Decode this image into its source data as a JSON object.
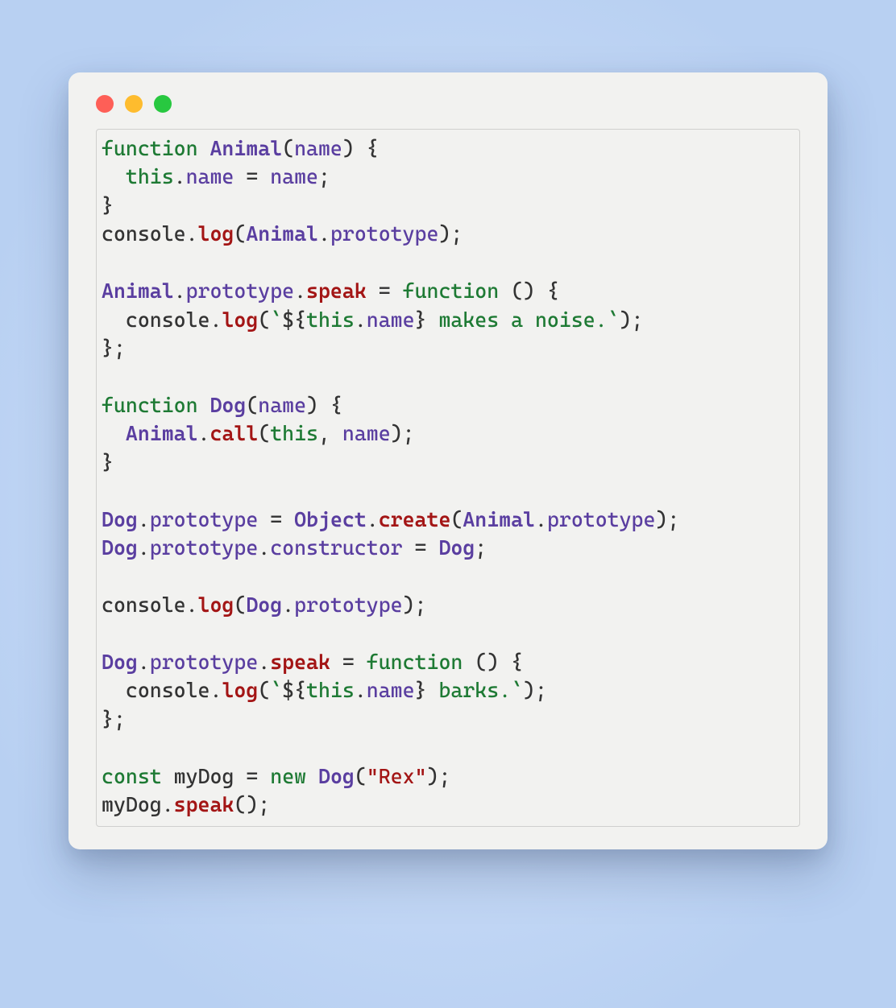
{
  "window": {
    "traffic_lights": [
      "close",
      "minimize",
      "zoom"
    ]
  },
  "code": {
    "lines": [
      [
        {
          "t": "kw",
          "v": "function"
        },
        {
          "t": "sp",
          "v": " "
        },
        {
          "t": "cls",
          "v": "Animal"
        },
        {
          "t": "paren",
          "v": "("
        },
        {
          "t": "prop",
          "v": "name"
        },
        {
          "t": "paren",
          "v": ")"
        },
        {
          "t": "sp",
          "v": " "
        },
        {
          "t": "brace",
          "v": "{"
        }
      ],
      [
        {
          "t": "sp",
          "v": "  "
        },
        {
          "t": "kw",
          "v": "this"
        },
        {
          "t": "dot",
          "v": "."
        },
        {
          "t": "prop",
          "v": "name"
        },
        {
          "t": "sp",
          "v": " "
        },
        {
          "t": "op",
          "v": "="
        },
        {
          "t": "sp",
          "v": " "
        },
        {
          "t": "prop",
          "v": "name"
        },
        {
          "t": "semi",
          "v": ";"
        }
      ],
      [
        {
          "t": "brace",
          "v": "}"
        }
      ],
      [
        {
          "t": "obj",
          "v": "console"
        },
        {
          "t": "dot",
          "v": "."
        },
        {
          "t": "meth",
          "v": "log"
        },
        {
          "t": "paren",
          "v": "("
        },
        {
          "t": "cls",
          "v": "Animal"
        },
        {
          "t": "dot",
          "v": "."
        },
        {
          "t": "prop",
          "v": "prototype"
        },
        {
          "t": "paren",
          "v": ")"
        },
        {
          "t": "semi",
          "v": ";"
        }
      ],
      [],
      [
        {
          "t": "cls",
          "v": "Animal"
        },
        {
          "t": "dot",
          "v": "."
        },
        {
          "t": "prop",
          "v": "prototype"
        },
        {
          "t": "dot",
          "v": "."
        },
        {
          "t": "meth",
          "v": "speak"
        },
        {
          "t": "sp",
          "v": " "
        },
        {
          "t": "op",
          "v": "="
        },
        {
          "t": "sp",
          "v": " "
        },
        {
          "t": "kw",
          "v": "function"
        },
        {
          "t": "sp",
          "v": " "
        },
        {
          "t": "paren",
          "v": "()"
        },
        {
          "t": "sp",
          "v": " "
        },
        {
          "t": "brace",
          "v": "{"
        }
      ],
      [
        {
          "t": "sp",
          "v": "  "
        },
        {
          "t": "obj",
          "v": "console"
        },
        {
          "t": "dot",
          "v": "."
        },
        {
          "t": "meth",
          "v": "log"
        },
        {
          "t": "paren",
          "v": "("
        },
        {
          "t": "tick",
          "v": "`"
        },
        {
          "t": "tmpl",
          "v": "${"
        },
        {
          "t": "kw",
          "v": "this"
        },
        {
          "t": "dot",
          "v": "."
        },
        {
          "t": "prop",
          "v": "name"
        },
        {
          "t": "tmpl",
          "v": "}"
        },
        {
          "t": "str",
          "v": " makes a noise."
        },
        {
          "t": "tick",
          "v": "`"
        },
        {
          "t": "paren",
          "v": ")"
        },
        {
          "t": "semi",
          "v": ";"
        }
      ],
      [
        {
          "t": "brace",
          "v": "}"
        },
        {
          "t": "semi",
          "v": ";"
        }
      ],
      [],
      [
        {
          "t": "kw",
          "v": "function"
        },
        {
          "t": "sp",
          "v": " "
        },
        {
          "t": "cls",
          "v": "Dog"
        },
        {
          "t": "paren",
          "v": "("
        },
        {
          "t": "prop",
          "v": "name"
        },
        {
          "t": "paren",
          "v": ")"
        },
        {
          "t": "sp",
          "v": " "
        },
        {
          "t": "brace",
          "v": "{"
        }
      ],
      [
        {
          "t": "sp",
          "v": "  "
        },
        {
          "t": "cls",
          "v": "Animal"
        },
        {
          "t": "dot",
          "v": "."
        },
        {
          "t": "meth",
          "v": "call"
        },
        {
          "t": "paren",
          "v": "("
        },
        {
          "t": "kw",
          "v": "this"
        },
        {
          "t": "op",
          "v": ","
        },
        {
          "t": "sp",
          "v": " "
        },
        {
          "t": "prop",
          "v": "name"
        },
        {
          "t": "paren",
          "v": ")"
        },
        {
          "t": "semi",
          "v": ";"
        }
      ],
      [
        {
          "t": "brace",
          "v": "}"
        }
      ],
      [],
      [
        {
          "t": "cls",
          "v": "Dog"
        },
        {
          "t": "dot",
          "v": "."
        },
        {
          "t": "prop",
          "v": "prototype"
        },
        {
          "t": "sp",
          "v": " "
        },
        {
          "t": "op",
          "v": "="
        },
        {
          "t": "sp",
          "v": " "
        },
        {
          "t": "cls",
          "v": "Object"
        },
        {
          "t": "dot",
          "v": "."
        },
        {
          "t": "meth",
          "v": "create"
        },
        {
          "t": "paren",
          "v": "("
        },
        {
          "t": "cls",
          "v": "Animal"
        },
        {
          "t": "dot",
          "v": "."
        },
        {
          "t": "prop",
          "v": "prototype"
        },
        {
          "t": "paren",
          "v": ")"
        },
        {
          "t": "semi",
          "v": ";"
        }
      ],
      [
        {
          "t": "cls",
          "v": "Dog"
        },
        {
          "t": "dot",
          "v": "."
        },
        {
          "t": "prop",
          "v": "prototype"
        },
        {
          "t": "dot",
          "v": "."
        },
        {
          "t": "prop",
          "v": "constructor"
        },
        {
          "t": "sp",
          "v": " "
        },
        {
          "t": "op",
          "v": "="
        },
        {
          "t": "sp",
          "v": " "
        },
        {
          "t": "cls",
          "v": "Dog"
        },
        {
          "t": "semi",
          "v": ";"
        }
      ],
      [],
      [
        {
          "t": "obj",
          "v": "console"
        },
        {
          "t": "dot",
          "v": "."
        },
        {
          "t": "meth",
          "v": "log"
        },
        {
          "t": "paren",
          "v": "("
        },
        {
          "t": "cls",
          "v": "Dog"
        },
        {
          "t": "dot",
          "v": "."
        },
        {
          "t": "prop",
          "v": "prototype"
        },
        {
          "t": "paren",
          "v": ")"
        },
        {
          "t": "semi",
          "v": ";"
        }
      ],
      [],
      [
        {
          "t": "cls",
          "v": "Dog"
        },
        {
          "t": "dot",
          "v": "."
        },
        {
          "t": "prop",
          "v": "prototype"
        },
        {
          "t": "dot",
          "v": "."
        },
        {
          "t": "meth",
          "v": "speak"
        },
        {
          "t": "sp",
          "v": " "
        },
        {
          "t": "op",
          "v": "="
        },
        {
          "t": "sp",
          "v": " "
        },
        {
          "t": "kw",
          "v": "function"
        },
        {
          "t": "sp",
          "v": " "
        },
        {
          "t": "paren",
          "v": "()"
        },
        {
          "t": "sp",
          "v": " "
        },
        {
          "t": "brace",
          "v": "{"
        }
      ],
      [
        {
          "t": "sp",
          "v": "  "
        },
        {
          "t": "obj",
          "v": "console"
        },
        {
          "t": "dot",
          "v": "."
        },
        {
          "t": "meth",
          "v": "log"
        },
        {
          "t": "paren",
          "v": "("
        },
        {
          "t": "tick",
          "v": "`"
        },
        {
          "t": "tmpl",
          "v": "${"
        },
        {
          "t": "kw",
          "v": "this"
        },
        {
          "t": "dot",
          "v": "."
        },
        {
          "t": "prop",
          "v": "name"
        },
        {
          "t": "tmpl",
          "v": "}"
        },
        {
          "t": "str",
          "v": " barks."
        },
        {
          "t": "tick",
          "v": "`"
        },
        {
          "t": "paren",
          "v": ")"
        },
        {
          "t": "semi",
          "v": ";"
        }
      ],
      [
        {
          "t": "brace",
          "v": "}"
        },
        {
          "t": "semi",
          "v": ";"
        }
      ],
      [],
      [
        {
          "t": "kw",
          "v": "const"
        },
        {
          "t": "sp",
          "v": " "
        },
        {
          "t": "obj",
          "v": "myDog"
        },
        {
          "t": "sp",
          "v": " "
        },
        {
          "t": "op",
          "v": "="
        },
        {
          "t": "sp",
          "v": " "
        },
        {
          "t": "kw",
          "v": "new"
        },
        {
          "t": "sp",
          "v": " "
        },
        {
          "t": "cls",
          "v": "Dog"
        },
        {
          "t": "paren",
          "v": "("
        },
        {
          "t": "strq",
          "v": "\"Rex\""
        },
        {
          "t": "paren",
          "v": ")"
        },
        {
          "t": "semi",
          "v": ";"
        }
      ],
      [
        {
          "t": "obj",
          "v": "myDog"
        },
        {
          "t": "dot",
          "v": "."
        },
        {
          "t": "meth",
          "v": "speak"
        },
        {
          "t": "paren",
          "v": "()"
        },
        {
          "t": "semi",
          "v": ";"
        }
      ]
    ]
  }
}
